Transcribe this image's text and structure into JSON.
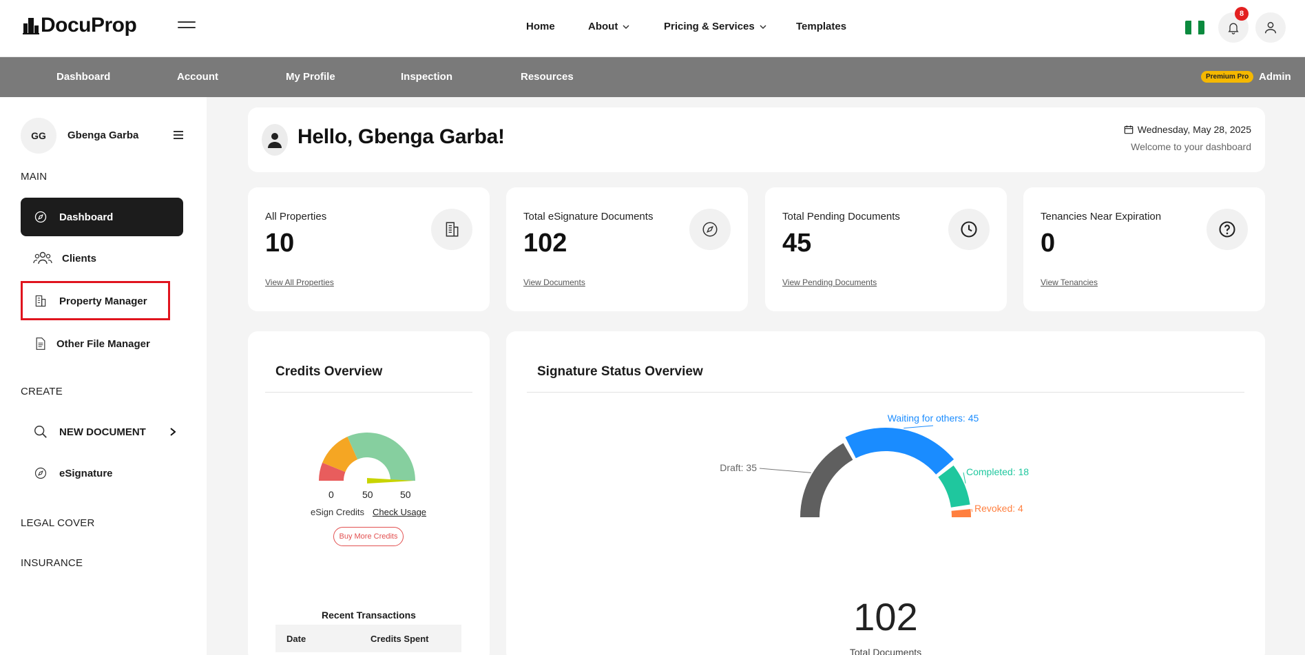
{
  "brand": {
    "name": "DocuProp"
  },
  "topnav": {
    "home": "Home",
    "about": "About",
    "pricing": "Pricing & Services",
    "templates": "Templates"
  },
  "notifications": {
    "count": "8"
  },
  "subnav": {
    "items": [
      "Dashboard",
      "Account",
      "My Profile",
      "Inspection",
      "Resources"
    ],
    "plan": "Premium Pro",
    "role": "Admin"
  },
  "sidebar": {
    "initials": "GG",
    "user_name": "Gbenga Garba",
    "main_label": "MAIN",
    "main_items": [
      "Dashboard",
      "Clients",
      "Property Manager",
      "Other File Manager"
    ],
    "create_label": "CREATE",
    "create_items": [
      "NEW DOCUMENT",
      "eSignature"
    ],
    "legal_label": "LEGAL COVER",
    "insurance_label": "INSURANCE"
  },
  "header": {
    "greeting": "Hello, Gbenga Garba!",
    "date": "Wednesday, May 28, 2025",
    "welcome": "Welcome to your dashboard"
  },
  "stats": [
    {
      "label": "All Properties",
      "value": "10",
      "link": "View All Properties",
      "icon": "building-icon"
    },
    {
      "label": "Total eSignature Documents",
      "value": "102",
      "link": "View Documents",
      "icon": "compass-icon"
    },
    {
      "label": "Total Pending Documents",
      "value": "45",
      "link": "View Pending Documents",
      "icon": "clock-icon"
    },
    {
      "label": "Tenancies Near Expiration",
      "value": "0",
      "link": "View Tenancies",
      "icon": "question-icon"
    }
  ],
  "credits": {
    "title": "Credits Overview",
    "gauge_min": "0",
    "gauge_value": "50",
    "gauge_max": "50",
    "esign_label": "eSign Credits",
    "check_usage": "Check Usage",
    "buy_button": "Buy More Credits",
    "recent_title": "Recent Transactions",
    "table_headers": [
      "Date",
      "Credits Spent"
    ],
    "colors": {
      "low": "#e85d5d",
      "mid": "#f5a623",
      "high": "#86cf9f",
      "needle": "#c8d400"
    }
  },
  "signature": {
    "title": "Signature Status Overview",
    "total": "102",
    "total_label": "Total Documents"
  },
  "chart_data": {
    "type": "pie",
    "title": "Signature Status Overview",
    "categories": [
      "Draft",
      "Waiting for others",
      "Completed",
      "Revoked"
    ],
    "values": [
      35,
      45,
      18,
      4
    ],
    "labels": [
      "Draft: 35",
      "Waiting for others: 45",
      "Completed: 18",
      "Revoked: 4"
    ],
    "colors": [
      "#5f5f5f",
      "#1a8cff",
      "#1fc79e",
      "#ff7f3f"
    ],
    "total": 102
  }
}
